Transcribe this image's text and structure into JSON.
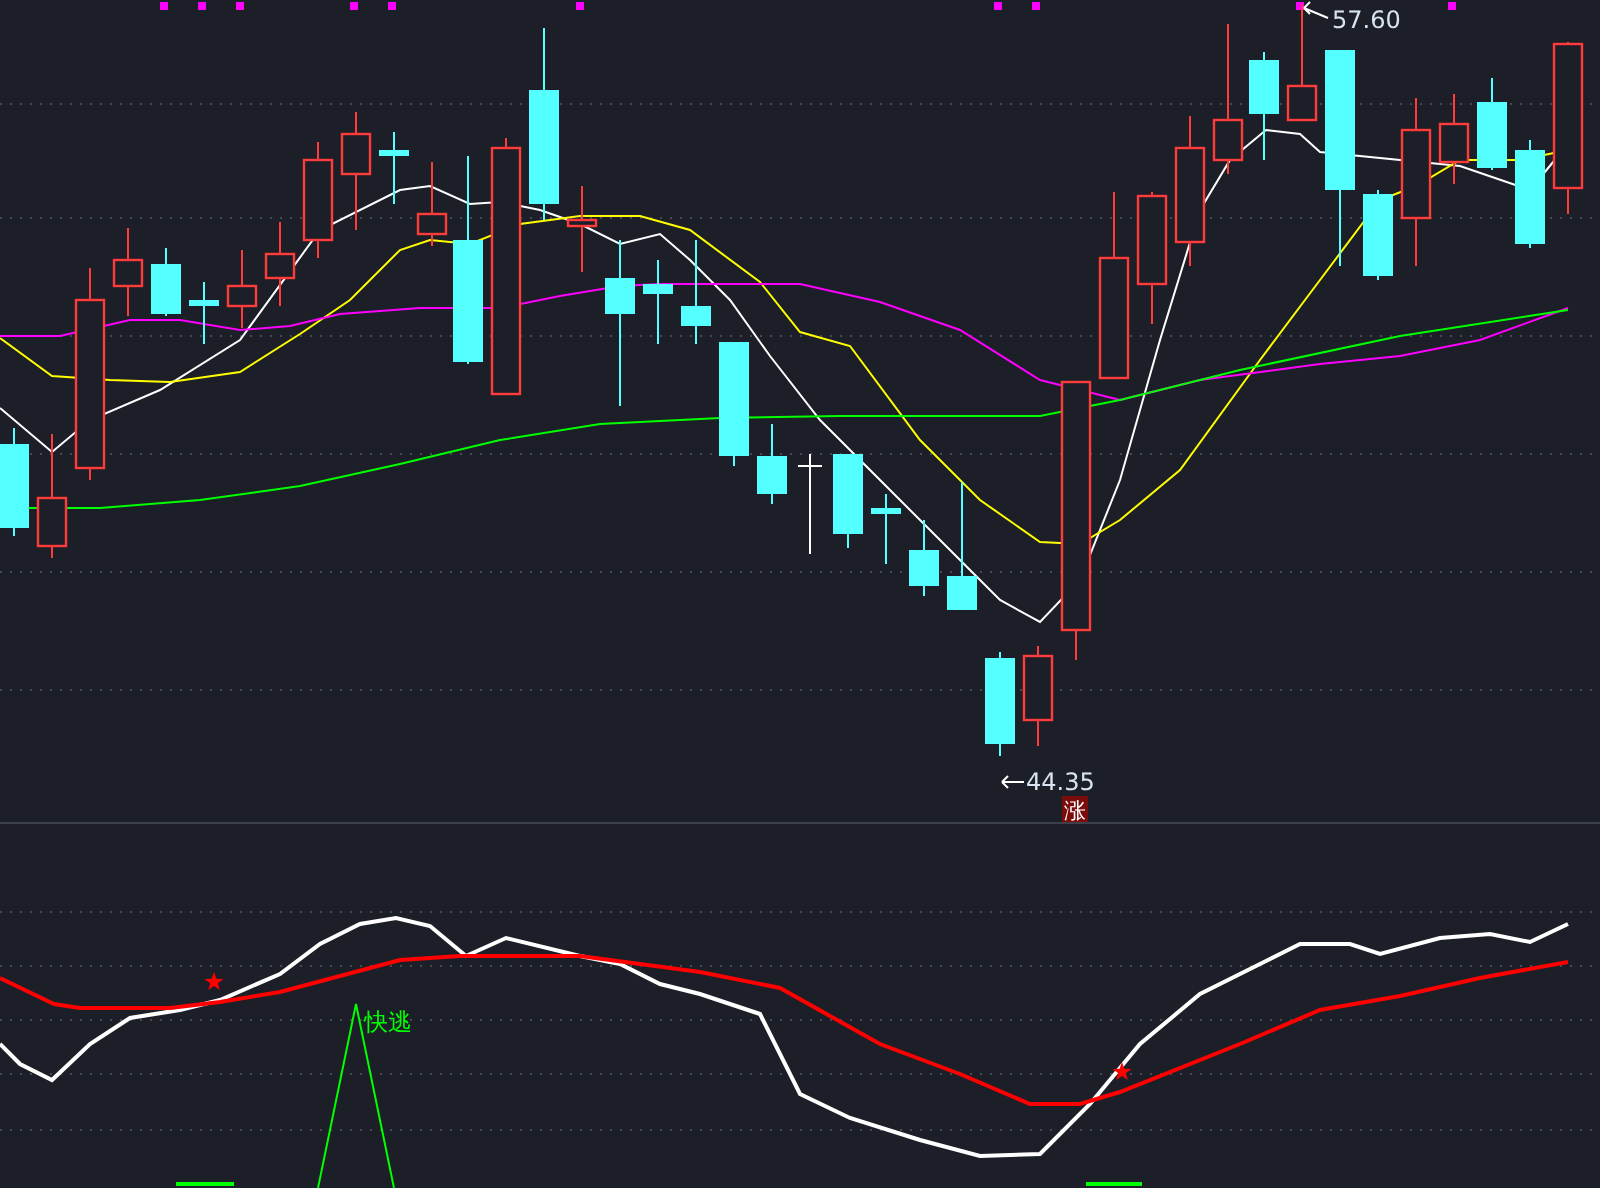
{
  "price_chart": {
    "high_label": "57.60",
    "low_label": "44.35",
    "signal_badge": "涨"
  },
  "indicator_chart": {
    "signal_label": "快逃"
  }
}
